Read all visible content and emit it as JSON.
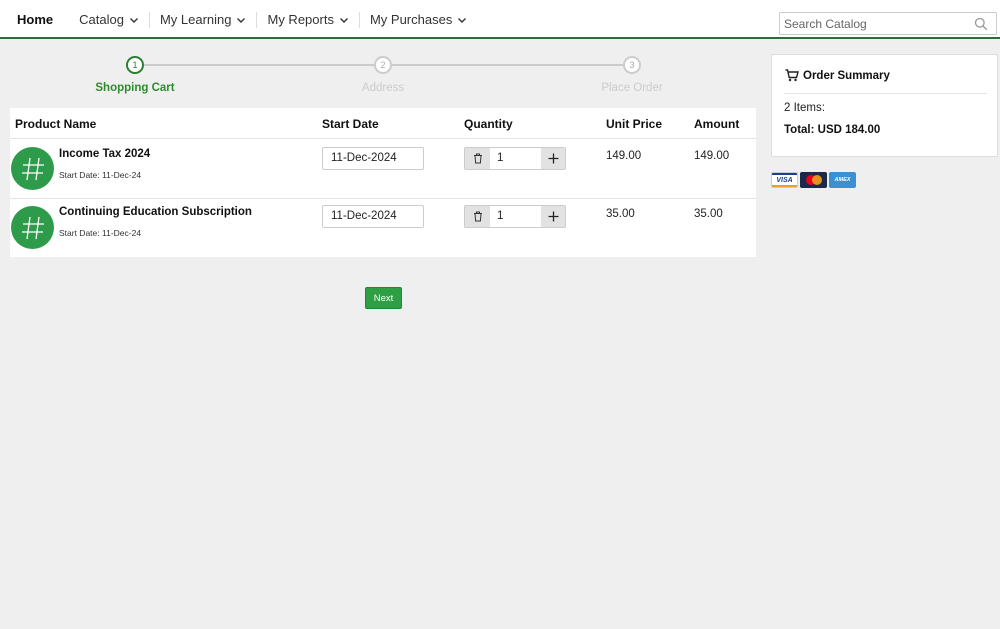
{
  "nav": {
    "home": "Home",
    "catalog": "Catalog",
    "my_learning": "My Learning",
    "my_reports": "My Reports",
    "my_purchases": "My Purchases",
    "search_placeholder": "Search Catalog"
  },
  "steps": [
    {
      "number": "1",
      "label": "Shopping Cart",
      "active": true
    },
    {
      "number": "2",
      "label": "Address",
      "active": false
    },
    {
      "number": "3",
      "label": "Place Order",
      "active": false
    }
  ],
  "table": {
    "headers": {
      "product": "Product Name",
      "start_date": "Start Date",
      "quantity": "Quantity",
      "unit_price": "Unit Price",
      "amount": "Amount"
    },
    "rows": [
      {
        "name": "Income Tax 2024",
        "sub": "Start Date: 11-Dec-24",
        "start_date": "11-Dec-2024",
        "quantity": "1",
        "unit_price": "149.00",
        "amount": "149.00"
      },
      {
        "name": "Continuing Education Subscription",
        "sub": "Start Date: 11-Dec-24",
        "start_date": "11-Dec-2024",
        "quantity": "1",
        "unit_price": "35.00",
        "amount": "35.00"
      }
    ]
  },
  "next_label": "Next",
  "summary": {
    "title": "Order Summary",
    "items": "2 Items:",
    "total": "Total: USD 184.00"
  },
  "cards": {
    "visa": "VISA",
    "amex": "AMEX"
  },
  "colors": {
    "accent": "#2e9b4a",
    "nav_border": "#2e6b3a",
    "background": "#efefef"
  }
}
